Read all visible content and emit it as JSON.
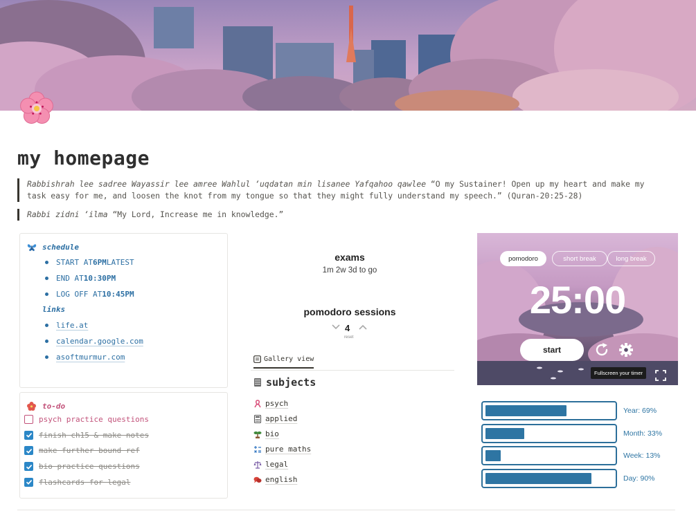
{
  "page": {
    "title": "my homepage",
    "quote1": {
      "italic": "Rabbishrah lee sadree Wayassir lee amree Wahlul ‘uqdatan min lisanee Yafqahoo qawlee",
      "plain": " “O my Sustainer! Open up my heart and make my task easy for me, and loosen the knot from my tongue so that they might fully understand my speech.” (Quran-20:25-28)"
    },
    "quote2": {
      "italic": "Rabbi zidni ‘ilma",
      "plain": " “My Lord, Increase me in knowledge.”"
    }
  },
  "schedule": {
    "heading": "schedule",
    "items": [
      {
        "pre": "START AT ",
        "bold": "6PM",
        "post": " LATEST"
      },
      {
        "pre": "END AT ",
        "bold": "10:30PM",
        "post": ""
      },
      {
        "pre": "LOG OFF AT ",
        "bold": "10:45PM",
        "post": ""
      }
    ],
    "links_heading": "links",
    "links": [
      "life.at",
      "calendar.google.com",
      "asoftmurmur.com"
    ]
  },
  "todo": {
    "heading": "to-do",
    "items": [
      {
        "label": "psych practice questions",
        "done": false
      },
      {
        "label": "finish ch15 & make notes",
        "done": true
      },
      {
        "label": "make further bound ref",
        "done": true
      },
      {
        "label": "bio practice questions",
        "done": true
      },
      {
        "label": "flashcards for legal",
        "done": true
      }
    ]
  },
  "exams": {
    "title": "exams",
    "countdown": "1m 2w 3d to go"
  },
  "pomodoro_sessions": {
    "title": "pomodoro sessions",
    "count": "4",
    "reset": "reset"
  },
  "gallery": {
    "tab_label": "Gallery view",
    "title": "subjects",
    "items": [
      {
        "label": "psych",
        "icon": "ribbon-icon",
        "color": "#d94f7a"
      },
      {
        "label": "applied",
        "icon": "calculator-icon",
        "color": "#555555"
      },
      {
        "label": "bio",
        "icon": "seedling-icon",
        "color": "#3f8a3b"
      },
      {
        "label": "pure maths",
        "icon": "math-operators-icon",
        "color": "#3b7cc4"
      },
      {
        "label": "legal",
        "icon": "scales-icon",
        "color": "#7b5ea7"
      },
      {
        "label": "english",
        "icon": "speech-bubbles-icon",
        "color": "#d8443a"
      }
    ]
  },
  "pomodoro": {
    "tabs": [
      "pomodoro",
      "short break",
      "long break"
    ],
    "active_tab": 0,
    "time": "25:00",
    "start_label": "start",
    "fullscreen_tip": "Fullscreen your timer"
  },
  "progress": [
    {
      "label": "Year: 69%",
      "value": 0.69
    },
    {
      "label": "Month: 33%",
      "value": 0.33
    },
    {
      "label": "Week: 13%",
      "value": 0.13
    },
    {
      "label": "Day: 90%",
      "value": 0.9
    }
  ],
  "colors": {
    "accent_blue": "#2c6fa3",
    "accent_pink": "#c2527a",
    "progress_blue": "#2e75a3"
  }
}
